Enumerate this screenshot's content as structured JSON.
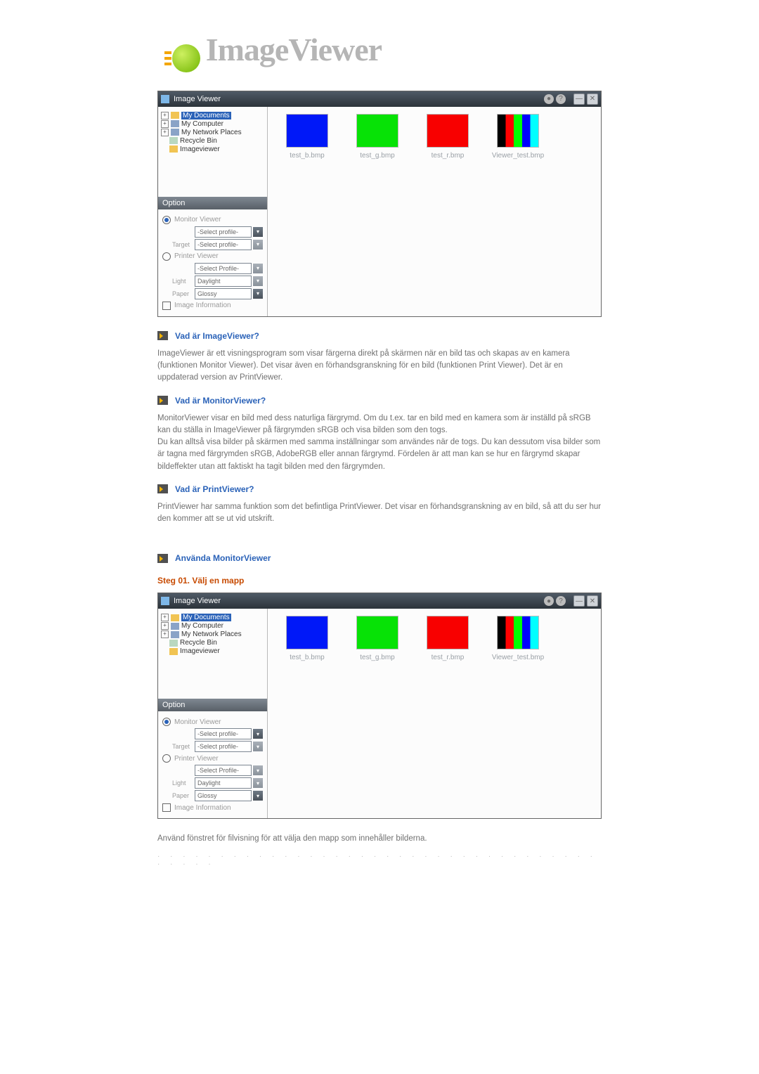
{
  "logo": {
    "text": "ImageViewer"
  },
  "appWindow": {
    "title": "Image Viewer",
    "tree": {
      "items": [
        {
          "label": "My Documents",
          "selected": true,
          "expandable": true
        },
        {
          "label": "My Computer",
          "selected": false,
          "expandable": true
        },
        {
          "label": "My Network Places",
          "selected": false,
          "expandable": true
        },
        {
          "label": "Recycle Bin",
          "selected": false,
          "expandable": false
        },
        {
          "label": "Imageviewer",
          "selected": false,
          "expandable": false
        }
      ]
    },
    "optionHeader": "Option",
    "monitorViewer": {
      "title": "Monitor Viewer",
      "profile": "-Select profile-",
      "targetLabel": "Target",
      "target": "-Select profile-"
    },
    "printerViewer": {
      "title": "Printer Viewer",
      "profile": "-Select Profile-",
      "lightLabel": "Light",
      "light": "Daylight",
      "paperLabel": "Paper",
      "paper": "Glossy"
    },
    "imageInfo": {
      "label": "Image Information"
    },
    "thumbs": [
      {
        "name": "test_b.bmp",
        "cls": "c-blue"
      },
      {
        "name": "test_g.bmp",
        "cls": "c-green"
      },
      {
        "name": "test_r.bmp",
        "cls": "c-red"
      },
      {
        "name": "Viewer_test.bmp",
        "cls": "c-mix"
      }
    ]
  },
  "sections": {
    "q1": {
      "title": "Vad är ImageViewer?",
      "body": "ImageViewer är ett visningsprogram som visar färgerna direkt på skärmen när en bild tas och skapas av en kamera (funktionen Monitor Viewer). Det visar även en förhandsgranskning för en bild (funktionen Print Viewer). Det är en uppdaterad version av PrintViewer."
    },
    "q2": {
      "title": "Vad är MonitorViewer?",
      "body": "MonitorViewer visar en bild med dess naturliga färgrymd. Om du t.ex. tar en bild med en kamera som är inställd på sRGB kan du ställa in ImageViewer på färgrymden sRGB och visa bilden som den togs.\nDu kan alltså visa bilder på skärmen med samma inställningar som användes när de togs. Du kan dessutom visa bilder som är tagna med färgrymden sRGB, AdobeRGB eller annan färgrymd. Fördelen är att man kan se hur en färgrymd skapar bildeffekter utan att faktiskt ha tagit bilden med den färgrymden."
    },
    "q3": {
      "title": "Vad är PrintViewer?",
      "body": "PrintViewer har samma funktion som det befintliga PrintViewer. Det visar en förhandsgranskning av en bild, så att du ser hur den kommer att se ut vid utskrift."
    },
    "use": {
      "title": "Använda MonitorViewer"
    },
    "step1": {
      "title": "Steg 01. Välj en mapp",
      "caption": "Använd fönstret för filvisning för att välja den mapp som innehåller bilderna."
    }
  }
}
